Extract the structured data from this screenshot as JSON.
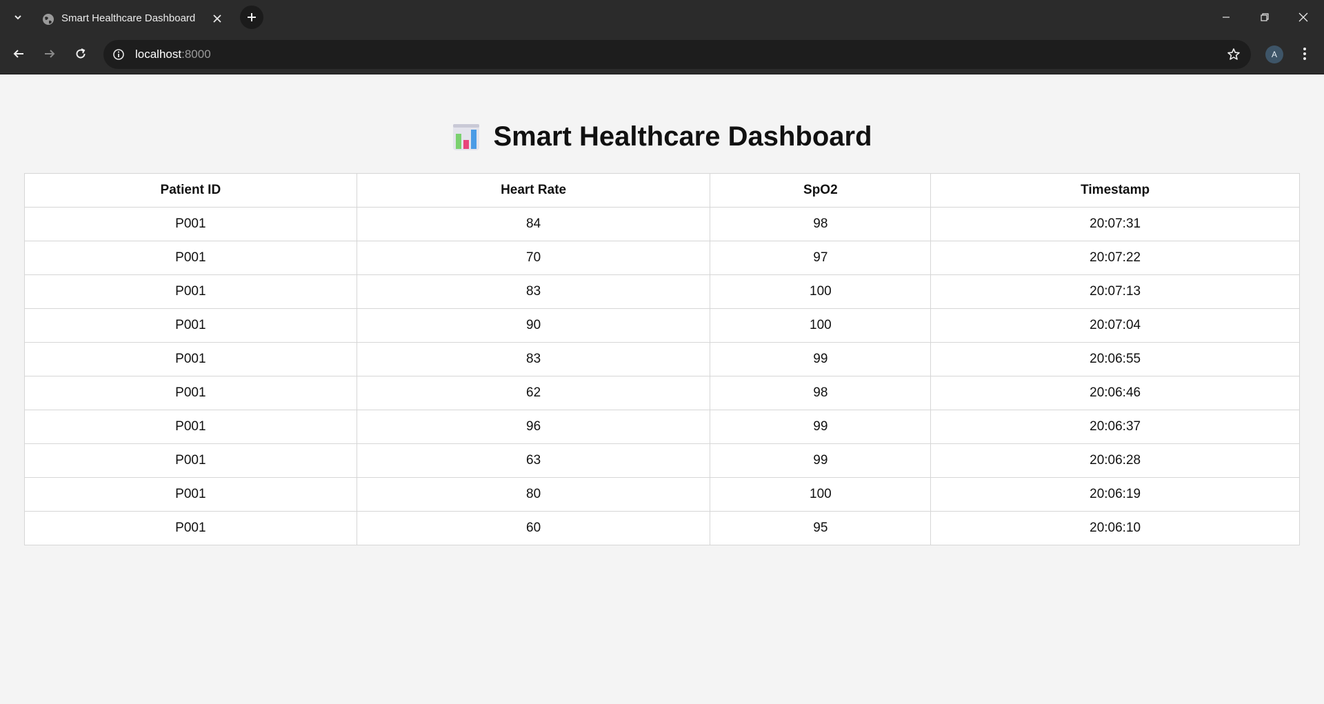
{
  "browser": {
    "tab_title": "Smart Healthcare Dashboard",
    "url_host": "localhost",
    "url_port": ":8000",
    "profile_initial": "A"
  },
  "page": {
    "title": "Smart Healthcare Dashboard",
    "title_icon": "bar-chart-icon"
  },
  "table": {
    "headers": [
      "Patient ID",
      "Heart Rate",
      "SpO2",
      "Timestamp"
    ],
    "rows": [
      [
        "P001",
        "84",
        "98",
        "20:07:31"
      ],
      [
        "P001",
        "70",
        "97",
        "20:07:22"
      ],
      [
        "P001",
        "83",
        "100",
        "20:07:13"
      ],
      [
        "P001",
        "90",
        "100",
        "20:07:04"
      ],
      [
        "P001",
        "83",
        "99",
        "20:06:55"
      ],
      [
        "P001",
        "62",
        "98",
        "20:06:46"
      ],
      [
        "P001",
        "96",
        "99",
        "20:06:37"
      ],
      [
        "P001",
        "63",
        "99",
        "20:06:28"
      ],
      [
        "P001",
        "80",
        "100",
        "20:06:19"
      ],
      [
        "P001",
        "60",
        "95",
        "20:06:10"
      ]
    ]
  }
}
